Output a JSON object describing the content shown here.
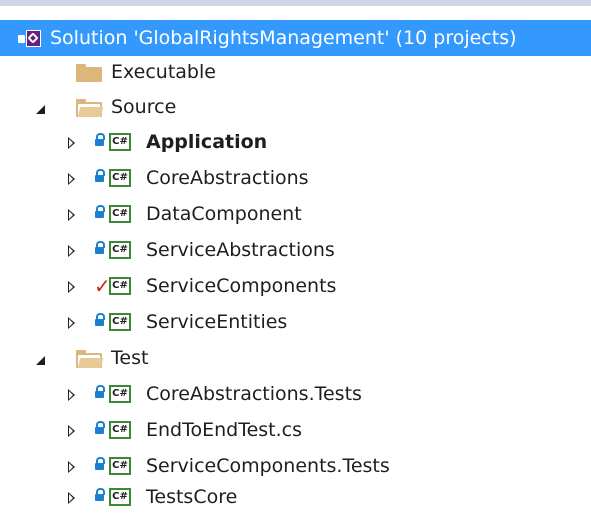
{
  "solution": {
    "label": "Solution 'GlobalRightsManagement' (10 projects)",
    "icon": "visual-studio-solution-icon",
    "selected_color": "#3399ff"
  },
  "folders": [
    {
      "label": "Executable",
      "icon": "folder-icon",
      "expanded": null
    },
    {
      "label": "Source",
      "icon": "folder-open-icon",
      "expanded": true
    },
    {
      "label": "Test",
      "icon": "folder-open-icon",
      "expanded": true
    }
  ],
  "source_projects": [
    {
      "label": "Application",
      "status_icon": "lock-icon",
      "bold": true
    },
    {
      "label": "CoreAbstractions",
      "status_icon": "lock-icon"
    },
    {
      "label": "DataComponent",
      "status_icon": "lock-icon"
    },
    {
      "label": "ServiceAbstractions",
      "status_icon": "lock-icon"
    },
    {
      "label": "ServiceComponents",
      "status_icon": "check-icon"
    },
    {
      "label": "ServiceEntities",
      "status_icon": "lock-icon"
    }
  ],
  "test_projects": [
    {
      "label": "CoreAbstractions.Tests",
      "status_icon": "lock-icon"
    },
    {
      "label": "EndToEndTest.cs",
      "status_icon": "lock-icon"
    },
    {
      "label": "ServiceComponents.Tests",
      "status_icon": "lock-icon"
    },
    {
      "label": "TestsCore",
      "status_icon": "lock-icon"
    }
  ],
  "project_type_label": "C#",
  "colors": {
    "cs_border": "#388a34",
    "lock": "#1c7fd1",
    "check": "#d11f1f",
    "folder": "#dcb67a"
  }
}
